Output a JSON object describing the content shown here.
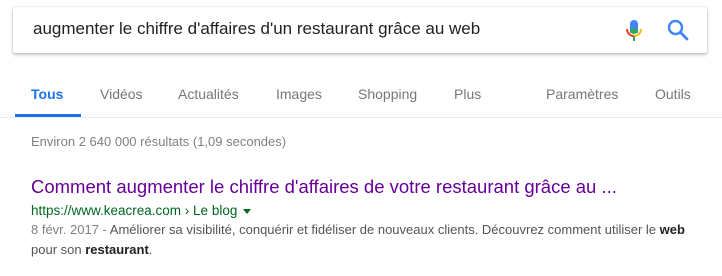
{
  "search": {
    "query": "augmenter le chiffre d'affaires d'un restaurant grâce au web"
  },
  "tabs": [
    {
      "label": "Tous",
      "active": true
    },
    {
      "label": "Vidéos"
    },
    {
      "label": "Actualités"
    },
    {
      "label": "Images"
    },
    {
      "label": "Shopping"
    },
    {
      "label": "Plus"
    },
    {
      "label": "Paramètres"
    },
    {
      "label": "Outils"
    }
  ],
  "results_stats": "Environ 2 640 000 résultats (1,09 secondes)",
  "result": {
    "title": "Comment augmenter le chiffre d'affaires de votre restaurant grâce au ...",
    "url": "https://www.keacrea.com › Le blog",
    "date": "8 févr. 2017",
    "snippet_parts": {
      "sep": " - ",
      "text1": "Améliorer sa visibilité, conquérir et fidéliser de nouveaux clients. Découvrez comment utiliser le ",
      "bold1": "web",
      "text2": " pour son ",
      "bold2": "restaurant",
      "text3": "."
    }
  },
  "colors": {
    "accent": "#1a73e8",
    "visited_link": "#660099",
    "url_green": "#006621"
  },
  "icons": [
    "mic-icon",
    "search-icon",
    "dropdown-caret-icon"
  ]
}
